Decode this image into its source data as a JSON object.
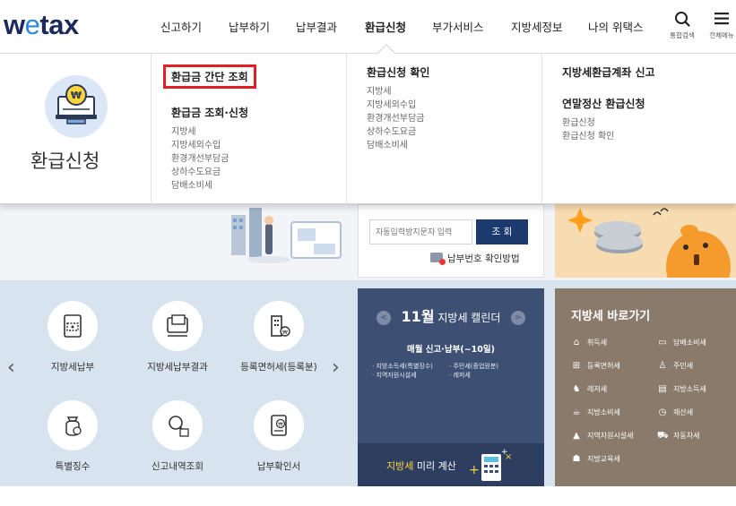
{
  "logo": {
    "part1": "w",
    "part2": "e",
    "part3": "tax"
  },
  "gnb": [
    {
      "label": "신고하기"
    },
    {
      "label": "납부하기"
    },
    {
      "label": "납부결과"
    },
    {
      "label": "환급신청"
    },
    {
      "label": "부가서비스"
    },
    {
      "label": "지방세정보"
    },
    {
      "label": "나의 위택스"
    }
  ],
  "header_buttons": {
    "search_caption": "통합검색",
    "menu_caption": "전체메뉴"
  },
  "mega": {
    "title": "환급신청",
    "col1": {
      "highlight": "환급금 간단 조회",
      "group": "환급금 조회·신청",
      "subs": [
        "지방세",
        "지방세외수입",
        "환경개선부담금",
        "상하수도요금",
        "담배소비세"
      ]
    },
    "col2": {
      "group": "환급신청 확인",
      "subs": [
        "지방세",
        "지방세외수입",
        "환경개선부담금",
        "상하수도요금",
        "담배소비세"
      ]
    },
    "col3": {
      "group1": "지방세환급계좌 신고",
      "group2": "연말정산 환급신청",
      "subs": [
        "환급신청",
        "환급신청 확인"
      ]
    }
  },
  "search": {
    "placeholder": "자동입력방지문자 입력",
    "button": "조 회",
    "howto": "납부번호 확인방법"
  },
  "quick": [
    {
      "label": "지방세납부"
    },
    {
      "label": "지방세납부결과"
    },
    {
      "label": "등록면허세(등록분)"
    },
    {
      "label": "특별징수"
    },
    {
      "label": "신고내역조회"
    },
    {
      "label": "납부확인서"
    }
  ],
  "calendar": {
    "month": "11월",
    "title": "지방세 캘린더",
    "prev": "<",
    "next": ">",
    "deadline": "매월 신고·납부(~10일)",
    "items": [
      "· 지방소득세(특별징수)",
      "· 주민세(종업원분)",
      "· 지역자원시설세",
      "· 레저세"
    ],
    "foot_accent": "지방세",
    "foot_rest": " 미리 계산"
  },
  "shortcut": {
    "title": "지방세 바로가기",
    "items": [
      {
        "label": "취득세"
      },
      {
        "label": "담배소비세"
      },
      {
        "label": "등록면허세"
      },
      {
        "label": "주민세"
      },
      {
        "label": "레저세"
      },
      {
        "label": "지방소득세"
      },
      {
        "label": "지방소비세"
      },
      {
        "label": "재산세"
      },
      {
        "label": "지역자원시설세"
      },
      {
        "label": "자동차세"
      },
      {
        "label": "지방교육세"
      }
    ]
  },
  "colors": {
    "highlight_border": "#e11e25",
    "brand_navy": "#1c2a5c",
    "calendar_bg": "#3d5074",
    "shortcut_bg": "#8a7a6b",
    "lower_bg": "#d7e3ef"
  }
}
